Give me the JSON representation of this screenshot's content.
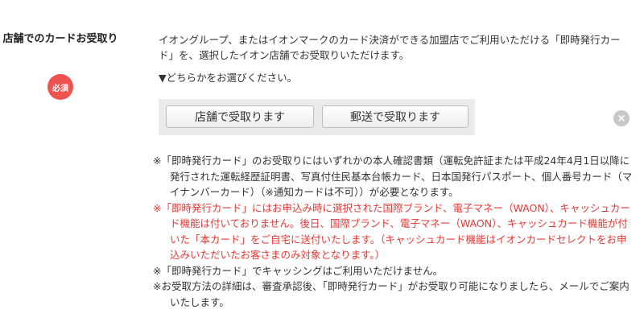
{
  "field": {
    "label": "店舗でのカードお受取り",
    "required_badge": "必須",
    "intro": "イオングループ、またはイオンマークのカード決済ができる加盟店でご利用いただける「即時発行カード」を、選択したイオン店舗でお受取りいただけます。",
    "choose_prompt": "▼どちらかをお選びください。"
  },
  "buttons": {
    "store": "店舗で受取ります",
    "mail": "郵送で受取ります"
  },
  "clear_icon": "×",
  "notes": [
    {
      "text": "※「即時発行カード」のお受取りにはいずれかの本人確認書類（運転免許証または平成24年4月1日以降に発行された運転経歴証明書、写真付住民基本台帳カード、日本国発行パスポート、個人番号カード（マイナンバーカード）（※通知カードは不可））が必要となります。",
      "color": "black"
    },
    {
      "text": "※「即時発行カード」にはお申込み時に選択された国際ブランド、電子マネー（WAON）、キャッシュカード機能は付いておりません。後日、国際ブランド、電子マネー（WAON）、キャッシュカード機能が付いた「本カード」をご自宅に送付いたします。（キャッシュカード機能はイオンカードセレクトをお申込みいただいたお客さまのみ対象となります。）",
      "color": "red"
    },
    {
      "text": "※「即時発行カード」でキャッシングはご利用いただけません。",
      "color": "black"
    },
    {
      "text": "※お受取方法の詳細は、審査承認後、「即時発行カード」がお受取り可能になりましたら、メールでご案内いたします。",
      "color": "black"
    }
  ],
  "colors": {
    "required": "#ef5350",
    "warning_text": "#e53935",
    "button_area": "#ebebeb"
  }
}
